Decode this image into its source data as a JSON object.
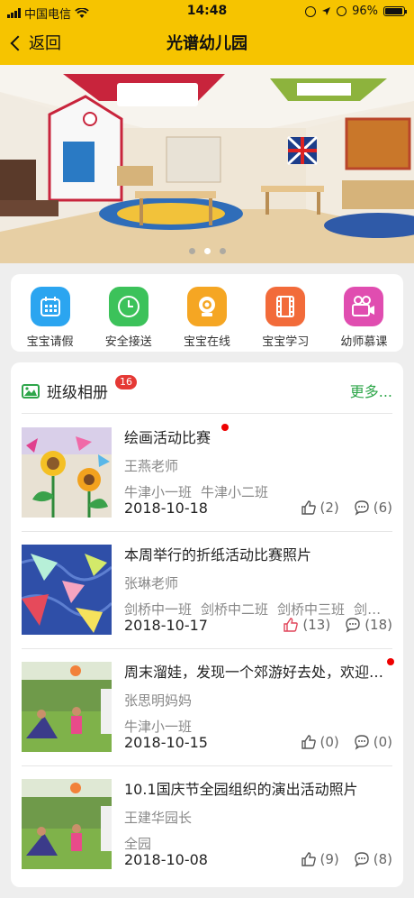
{
  "status": {
    "carrier": "中国电信",
    "time": "14:48",
    "battery": "96%"
  },
  "nav": {
    "back_label": "返回",
    "title": "光谱幼儿园"
  },
  "menu": [
    {
      "label": "宝宝请假",
      "color": "#2ba5f0",
      "icon": "calendar-icon"
    },
    {
      "label": "安全接送",
      "color": "#3cc25a",
      "icon": "clock-icon"
    },
    {
      "label": "宝宝在线",
      "color": "#f5a623",
      "icon": "webcam-icon"
    },
    {
      "label": "宝宝学习",
      "color": "#f26b3a",
      "icon": "film-icon"
    },
    {
      "label": "幼师慕课",
      "color": "#e04db0",
      "icon": "video-camera-icon"
    }
  ],
  "album": {
    "title": "班级相册",
    "badge": "16",
    "more": "更多...",
    "items": [
      {
        "title": "绘画活动比赛",
        "new": true,
        "author": "王燕老师",
        "classes": [
          "牛津小一班",
          "牛津小二班"
        ],
        "date": "2018-10-18",
        "likes": "(2)",
        "comments": "(6)",
        "liked": false
      },
      {
        "title": "本周举行的折纸活动比赛照片",
        "new": false,
        "author": "张琳老师",
        "classes": [
          "剑桥中一班",
          "剑桥中二班",
          "剑桥中三班",
          "剑桥中四班"
        ],
        "date": "2018-10-17",
        "likes": "(13)",
        "comments": "(18)",
        "liked": true
      },
      {
        "title": "周末溜娃，发现一个郊游好去处，欢迎大家一起来",
        "new": true,
        "author": "张思明妈妈",
        "classes": [
          "牛津小一班"
        ],
        "date": "2018-10-15",
        "likes": "(0)",
        "comments": "(0)",
        "liked": false
      },
      {
        "title": "10.1国庆节全园组织的演出活动照片",
        "new": false,
        "author": "王建华园长",
        "classes": [
          "全园"
        ],
        "date": "2018-10-08",
        "likes": "(9)",
        "comments": "(8)",
        "liked": false
      }
    ]
  }
}
